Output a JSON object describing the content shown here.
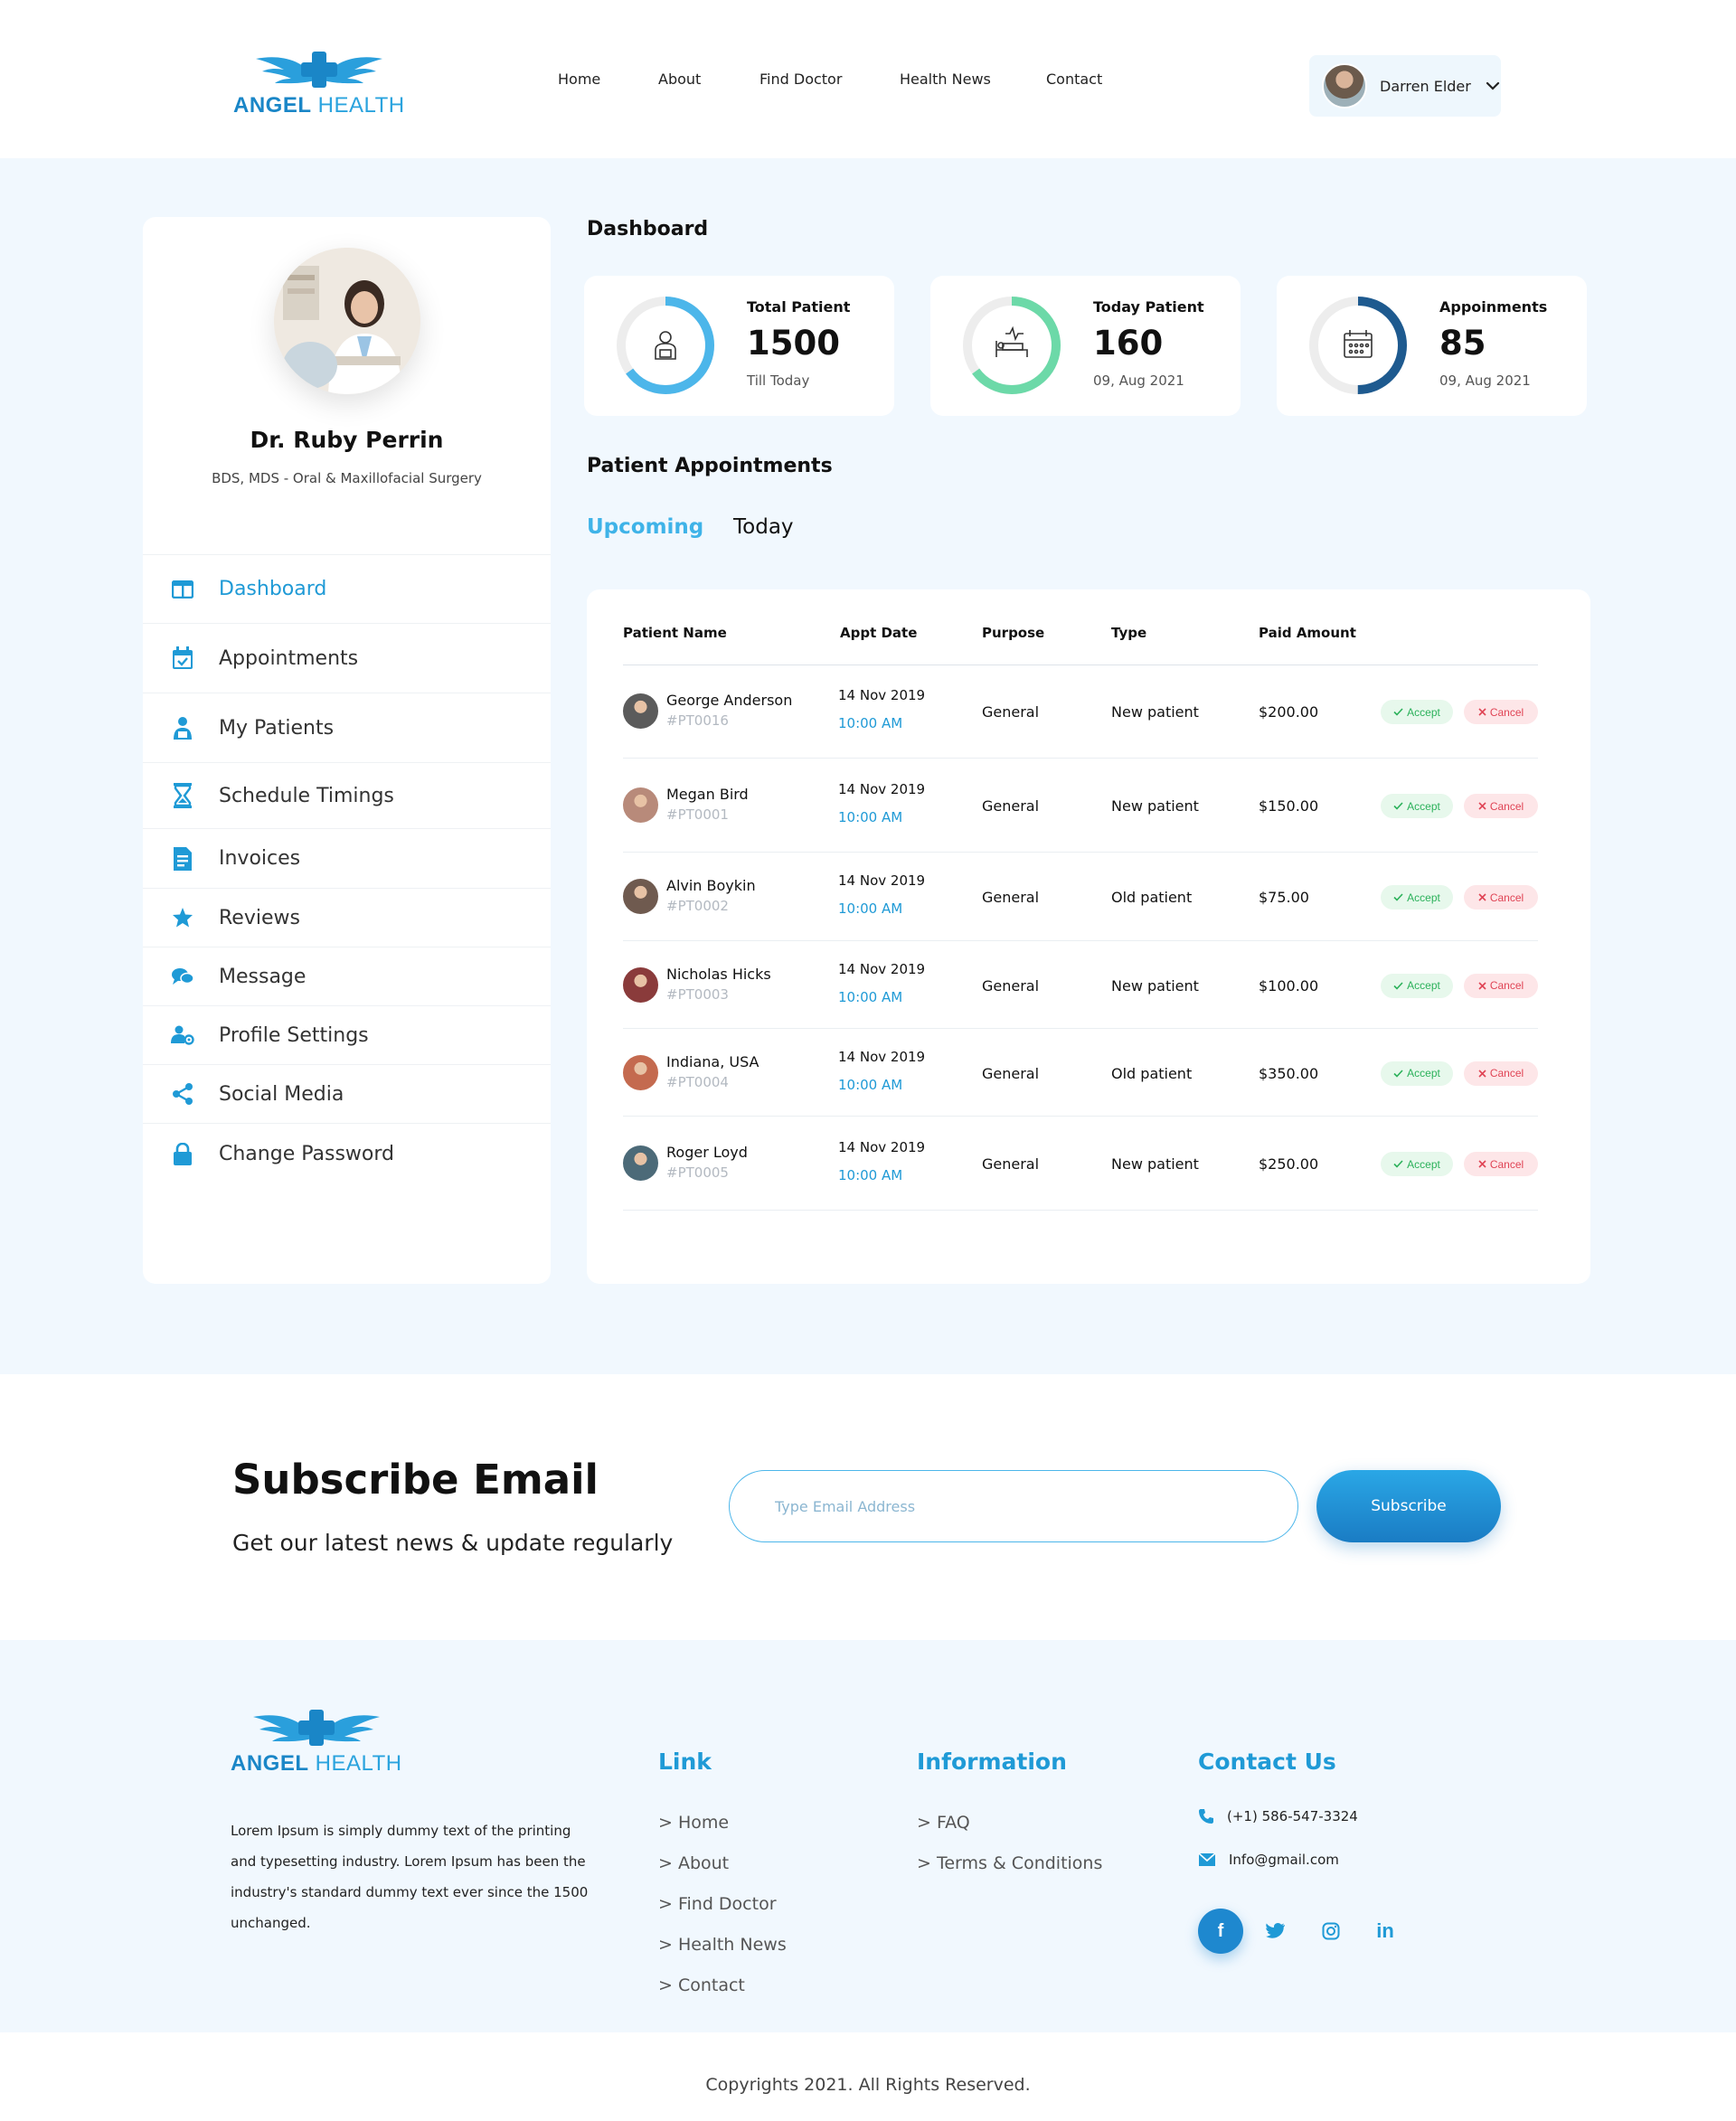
{
  "brand": {
    "part1": "ANGEL",
    "part2": "HEALTH"
  },
  "nav": [
    {
      "label": "Home"
    },
    {
      "label": "About"
    },
    {
      "label": "Find Doctor"
    },
    {
      "label": "Health News"
    },
    {
      "label": "Contact"
    }
  ],
  "user": {
    "name": "Darren Elder"
  },
  "doctor": {
    "name": "Dr. Ruby Perrin",
    "degree": "BDS, MDS - Oral & Maxillofacial Surgery"
  },
  "menu": [
    {
      "label": "Dashboard",
      "icon": "dashboard-icon",
      "active": true
    },
    {
      "label": "Appointments",
      "icon": "calendar-check-icon"
    },
    {
      "label": "My Patients",
      "icon": "patients-icon"
    },
    {
      "label": "Schedule Timings",
      "icon": "hourglass-icon"
    },
    {
      "label": "Invoices",
      "icon": "invoice-icon"
    },
    {
      "label": "Reviews",
      "icon": "star-icon"
    },
    {
      "label": "Message",
      "icon": "message-icon"
    },
    {
      "label": "Profile Settings",
      "icon": "user-cog-icon"
    },
    {
      "label": "Social Media",
      "icon": "share-icon"
    },
    {
      "label": "Change Password",
      "icon": "lock-icon"
    }
  ],
  "dashboard_title": "Dashboard",
  "stats": [
    {
      "label": "Total Patient",
      "value": "1500",
      "sub": "Till Today",
      "color": "#4cb6ea",
      "progress": 0.65,
      "icon": "patient-icon"
    },
    {
      "label": "Today Patient",
      "value": "160",
      "sub": "09, Aug 2021",
      "color": "#6cd9a8",
      "progress": 0.65,
      "icon": "hospital-bed-icon"
    },
    {
      "label": "Appoinments",
      "value": "85",
      "sub": "09, Aug 2021",
      "color": "#1e5a8f",
      "progress": 0.5,
      "icon": "calendar-icon"
    }
  ],
  "appointments_title": "Patient Appointments",
  "tabs": [
    {
      "label": "Upcoming"
    },
    {
      "label": "Today"
    }
  ],
  "table": {
    "headers": [
      "Patient Name",
      "Appt Date",
      "Purpose",
      "Type",
      "Paid Amount"
    ],
    "accept_label": "Accept",
    "cancel_label": "Cancel",
    "rows": [
      {
        "name": "George Anderson",
        "id": "#PT0016",
        "date": "14 Nov 2019",
        "time": "10:00 AM",
        "purpose": "General",
        "type": "New patient",
        "amount": "$200.00"
      },
      {
        "name": "Megan Bird",
        "id": "#PT0001",
        "date": "14 Nov 2019",
        "time": "10:00 AM",
        "purpose": "General",
        "type": "New patient",
        "amount": "$150.00"
      },
      {
        "name": "Alvin Boykin",
        "id": "#PT0002",
        "date": "14 Nov 2019",
        "time": "10:00 AM",
        "purpose": "General",
        "type": "Old patient",
        "amount": "$75.00"
      },
      {
        "name": "Nicholas Hicks",
        "id": "#PT0003",
        "date": "14 Nov 2019",
        "time": "10:00 AM",
        "purpose": "General",
        "type": "New patient",
        "amount": "$100.00"
      },
      {
        "name": "Indiana, USA",
        "id": "#PT0004",
        "date": "14 Nov 2019",
        "time": "10:00 AM",
        "purpose": "General",
        "type": "Old patient",
        "amount": "$350.00"
      },
      {
        "name": "Roger Loyd",
        "id": "#PT0005",
        "date": "14 Nov 2019",
        "time": "10:00 AM",
        "purpose": "General",
        "type": "New patient",
        "amount": "$250.00"
      }
    ]
  },
  "subscribe": {
    "title": "Subscribe Email",
    "text": "Get our latest news & update regularly",
    "placeholder": "Type Email Address",
    "button": "Subscribe"
  },
  "footer": {
    "description": "Lorem Ipsum is simply dummy text of the printing and typesetting industry. Lorem Ipsum has been the industry's standard dummy text ever since the 1500 unchanged.",
    "link_title": "Link",
    "links": [
      "> Home",
      "> About",
      "> Find Doctor",
      "> Health News",
      "> Contact"
    ],
    "info_title": "Information",
    "info_links": [
      "> FAQ",
      "> Terms & Conditions"
    ],
    "contact_title": "Contact Us",
    "phone": "(+1) 586-547-3324",
    "email": "Info@gmail.com",
    "copyright": "Copyrights 2021. All Rights Reserved."
  },
  "colors": {
    "accent": "#1f9ad6",
    "background": "#f1f8fe"
  }
}
